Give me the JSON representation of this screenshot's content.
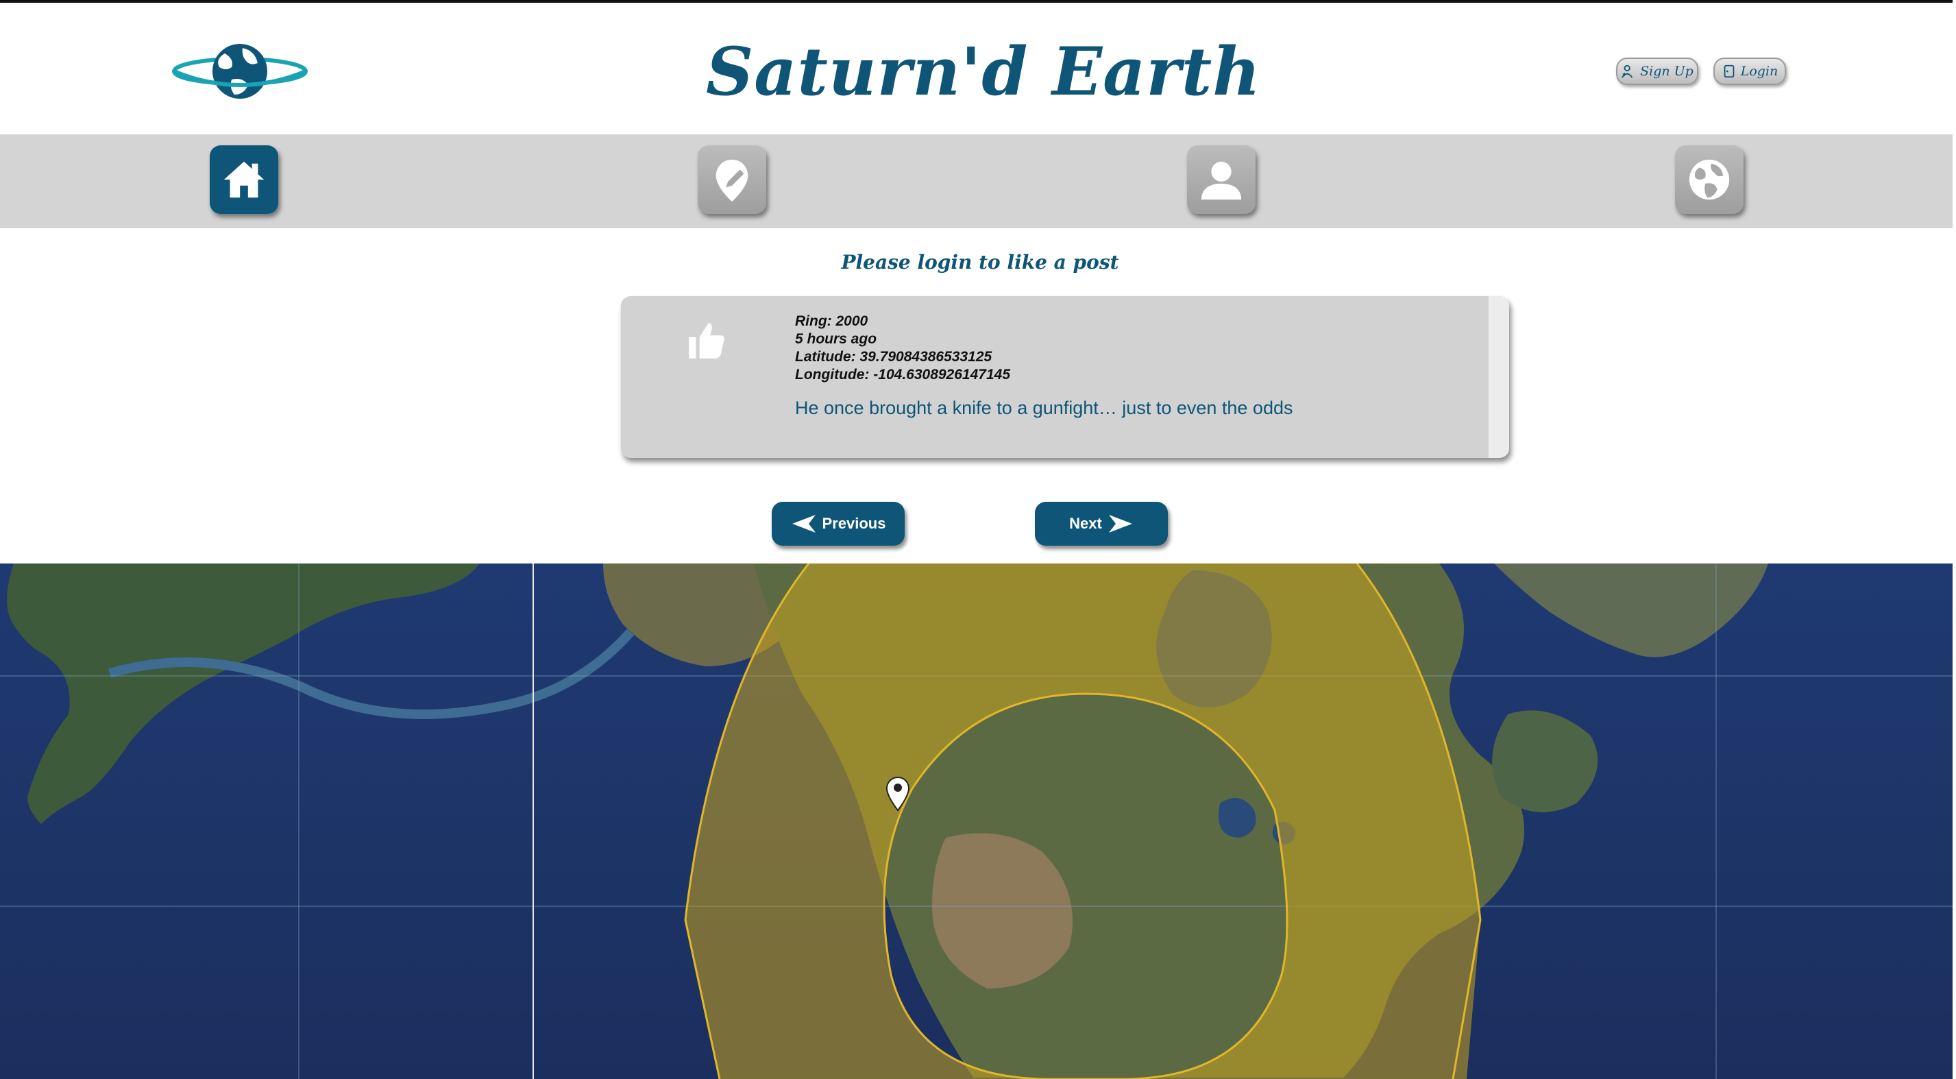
{
  "app": {
    "title": "Saturn'd Earth",
    "accent_color": "#0e5577",
    "logo_icon": "ringed-globe-logo"
  },
  "header": {
    "signup_label": "Sign Up",
    "login_label": "Login"
  },
  "nav": {
    "items": [
      {
        "name": "home",
        "icon": "home-icon",
        "active": true
      },
      {
        "name": "post",
        "icon": "location-edit-icon",
        "active": false
      },
      {
        "name": "profile",
        "icon": "user-icon",
        "active": false
      },
      {
        "name": "globe",
        "icon": "globe-icon",
        "active": false
      }
    ]
  },
  "prompt": "Please login to like a post",
  "post": {
    "ring": "Ring: 2000",
    "time": "5 hours ago",
    "latitude": "Latitude: 39.79084386533125",
    "longitude": "Longitude: -104.6308926147145",
    "text": "He once brought a knife to a gunfight… just to even the odds"
  },
  "pager": {
    "previous_label": "Previous",
    "next_label": "Next"
  },
  "map": {
    "type": "satellite",
    "inner_ring_color": "#b59a2a",
    "outer_ring_color": "#c9a21c"
  }
}
